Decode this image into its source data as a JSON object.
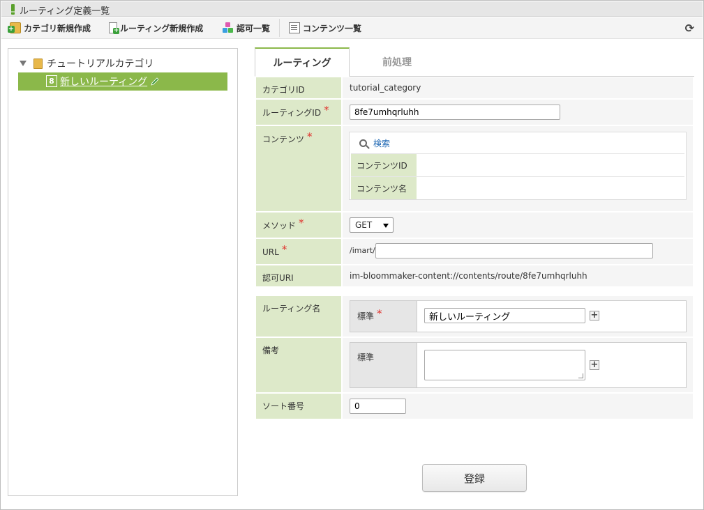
{
  "window": {
    "title": "ルーティング定義一覧"
  },
  "toolbar": {
    "new_category": "カテゴリ新規作成",
    "new_routing": "ルーティング新規作成",
    "authorization_list": "認可一覧",
    "contents_list": "コンテンツ一覧"
  },
  "tree": {
    "root_label": "チュートリアルカテゴリ",
    "items": [
      {
        "badge": "8",
        "label": "新しいルーティング",
        "selected": true
      }
    ]
  },
  "tabs": [
    {
      "label": "ルーティング",
      "active": true
    },
    {
      "label": "前処理",
      "active": false
    }
  ],
  "form": {
    "category_id_label": "カテゴリID",
    "category_id_value": "tutorial_category",
    "routing_id_label": "ルーティングID",
    "routing_id_value": "8fe7umhqrluhh",
    "contents_label": "コンテンツ",
    "search_link": "検索",
    "contents_id_label": "コンテンツID",
    "contents_name_label": "コンテンツ名",
    "method_label": "メソッド",
    "method_value": "GET",
    "url_label": "URL",
    "url_prefix": "/imart/",
    "url_value": "",
    "auth_uri_label": "認可URI",
    "auth_uri_value": "im-bloommaker-content://contents/route/8fe7umhqrluhh",
    "routing_name_label": "ルーティング名",
    "routing_name_locale": "標準",
    "routing_name_value": "新しいルーティング",
    "note_label": "備考",
    "note_locale": "標準",
    "note_value": "",
    "sort_label": "ソート番号",
    "sort_value": "0",
    "required_mark": "*",
    "submit_label": "登録"
  },
  "colors": {
    "label_bg": "#dde9c9",
    "selected_bg": "#8bb84a",
    "required": "#e0332d",
    "link": "#1e67b3"
  }
}
